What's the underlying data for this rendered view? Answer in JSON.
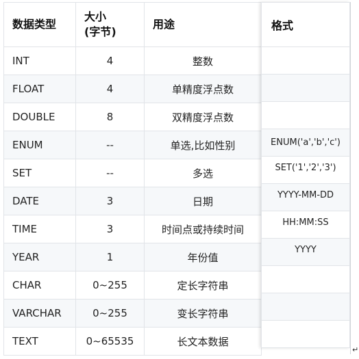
{
  "headers": {
    "type": "数据类型",
    "size_line1": "大小",
    "size_line2": "(字节)",
    "usage": "用途",
    "format": "格式"
  },
  "rows": [
    {
      "type": "INT",
      "size": "4",
      "usage": "整数",
      "format": ""
    },
    {
      "type": "FLOAT",
      "size": "4",
      "usage": "单精度浮点数",
      "format": ""
    },
    {
      "type": "DOUBLE",
      "size": "8",
      "usage": "双精度浮点数",
      "format": ""
    },
    {
      "type": "ENUM",
      "size": "--",
      "usage": "单选,比如性别",
      "format": "ENUM('a','b','c')"
    },
    {
      "type": "SET",
      "size": "--",
      "usage": "多选",
      "format": "SET('1','2','3')"
    },
    {
      "type": "DATE",
      "size": "3",
      "usage": "日期",
      "format": "YYYY-MM-DD"
    },
    {
      "type": "TIME",
      "size": "3",
      "usage": "时间点或持续时间",
      "format": "HH:MM:SS"
    },
    {
      "type": "YEAR",
      "size": "1",
      "usage": "年份值",
      "format": "YYYY"
    },
    {
      "type": "CHAR",
      "size": "0~255",
      "usage": "定长字符串",
      "format": ""
    },
    {
      "type": "VARCHAR",
      "size": "0~255",
      "usage": "变长字符串",
      "format": ""
    },
    {
      "type": "TEXT",
      "size": "0~65535",
      "usage": "长文本数据",
      "format": ""
    }
  ],
  "icons": {
    "paragraph_mark": "return-arrow-icon"
  }
}
